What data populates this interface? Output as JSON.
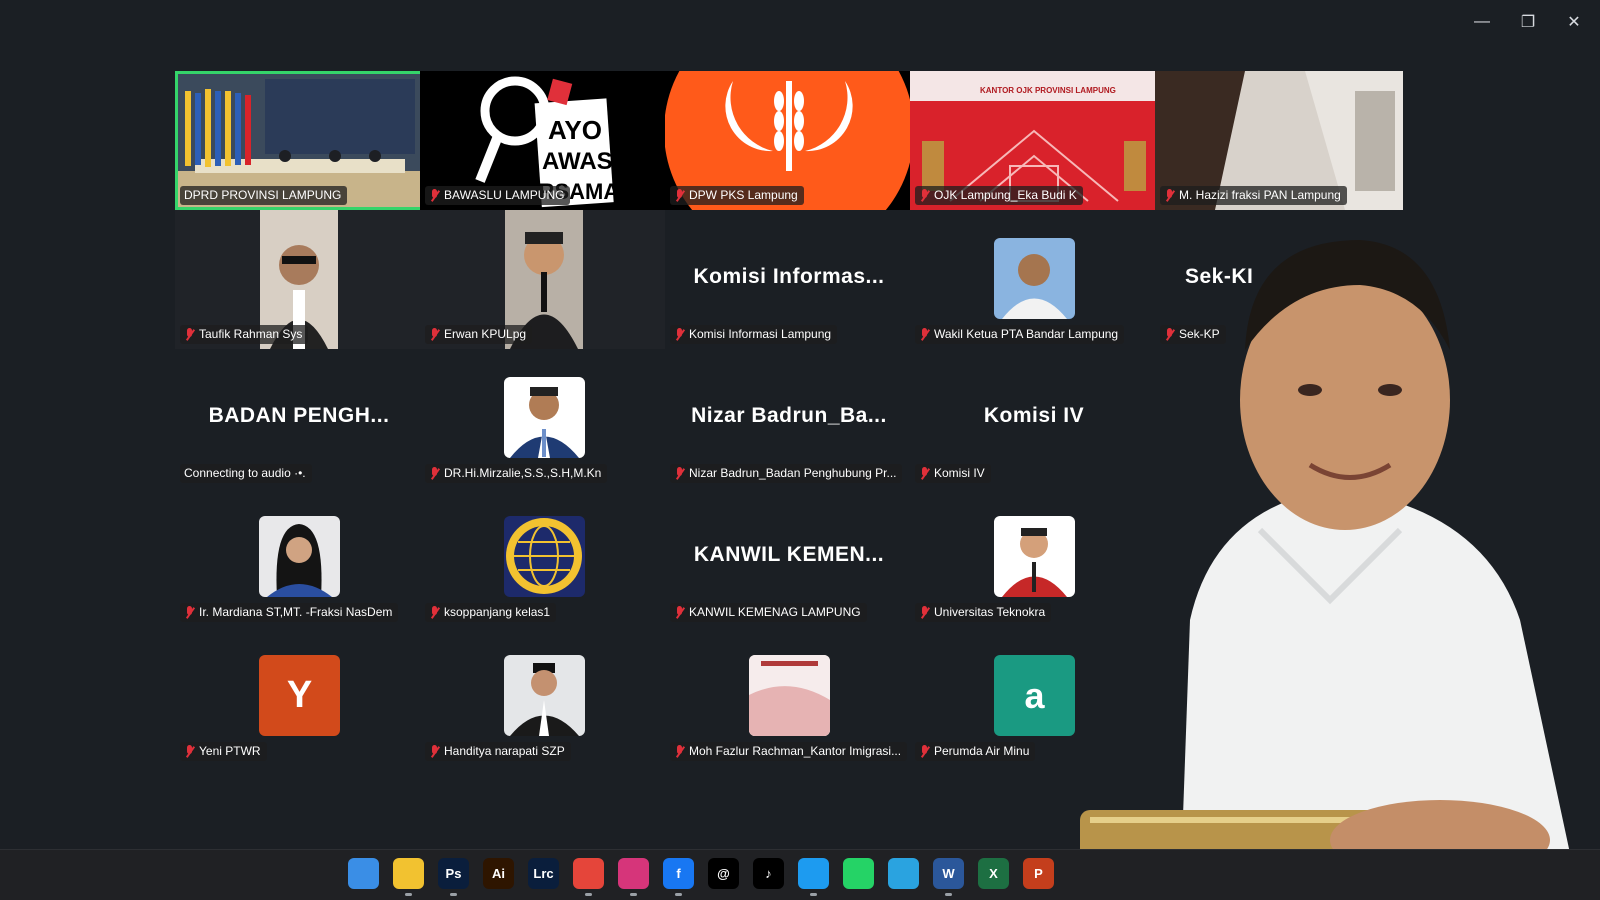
{
  "window": {
    "minimize_icon": "minimize-icon",
    "restore_icon": "restore-icon",
    "close_icon": "close-icon"
  },
  "tiles": [
    {
      "name": "DPRD PROVINSI LAMPUNG",
      "kind": "video",
      "muted": false,
      "active": true
    },
    {
      "name": "BAWASLU LAMPUNG",
      "kind": "logo",
      "logo_text": "AYO AWASI BERSAMA"
    },
    {
      "name": "DPW PKS Lampung",
      "kind": "logo"
    },
    {
      "name": "OJK Lampung_Eka Budi K",
      "kind": "banner",
      "banner_text": "KANTOR OJK PROVINSI LAMPUNG"
    },
    {
      "name": "M. Hazizi fraksi PAN Lampung",
      "kind": "video"
    },
    {
      "name": "Taufik Rahman Sys",
      "kind": "video"
    },
    {
      "name": "Erwan KPULpg",
      "kind": "video"
    },
    {
      "name": "Komisi Informasi Lampung",
      "kind": "text",
      "display": "Komisi  Informas..."
    },
    {
      "name": "Wakil Ketua  PTA Bandar Lampung",
      "kind": "avatar"
    },
    {
      "name": "Sek-KP",
      "kind": "text",
      "display": "Sek-KI"
    },
    {
      "name": "Connecting to audio ·•.",
      "kind": "text",
      "display": "BADAN  PENGH...",
      "connecting": true
    },
    {
      "name": "DR.Hi.Mirzalie,S.S.,S.H,M.Kn",
      "kind": "avatar"
    },
    {
      "name": "Nizar Badrun_Badan Penghubung Pr...",
      "kind": "text",
      "display": "Nizar  Badrun_Ba..."
    },
    {
      "name": "Komisi IV",
      "kind": "text",
      "display": "Komisi IV"
    },
    {
      "name": "Ir. Mardiana ST,MT. -Fraksi NasDem",
      "kind": "avatar"
    },
    {
      "name": "ksoppanjang kelas1",
      "kind": "avatar"
    },
    {
      "name": "KANWIL KEMENAG LAMPUNG",
      "kind": "text",
      "display": "KANWIL  KEMEN..."
    },
    {
      "name": "Universitas Teknokra",
      "kind": "avatar"
    },
    {
      "name": "Yeni PTWR",
      "kind": "letter",
      "letter": "Y"
    },
    {
      "name": "Handitya narapati SZP",
      "kind": "avatar"
    },
    {
      "name": "Moh Fazlur Rachman_Kantor Imigrasi...",
      "kind": "avatar"
    },
    {
      "name": "Perumda Air Minu",
      "kind": "letter",
      "letter": "a"
    }
  ],
  "taskbar": {
    "items": [
      {
        "icon": "windows-start-icon",
        "label": "",
        "color": "#3a8ee6"
      },
      {
        "icon": "file-explorer-icon",
        "label": "",
        "color": "#f2c230"
      },
      {
        "icon": "photoshop-icon",
        "label": "Ps",
        "color": "#0a1e3c"
      },
      {
        "icon": "illustrator-icon",
        "label": "Ai",
        "color": "#2e1500"
      },
      {
        "icon": "lightroom-classic-icon",
        "label": "Lrc",
        "color": "#0a1e3c"
      },
      {
        "icon": "chrome-icon",
        "label": "",
        "color": "#e5453a"
      },
      {
        "icon": "instagram-icon",
        "label": "",
        "color": "#d6357a"
      },
      {
        "icon": "facebook-icon",
        "label": "f",
        "color": "#1877f2"
      },
      {
        "icon": "threads-icon",
        "label": "@",
        "color": "#000000"
      },
      {
        "icon": "tiktok-icon",
        "label": "♪",
        "color": "#000000"
      },
      {
        "icon": "twitter-icon",
        "label": "",
        "color": "#1d9bf0"
      },
      {
        "icon": "whatsapp-icon",
        "label": "",
        "color": "#25d366"
      },
      {
        "icon": "telegram-icon",
        "label": "",
        "color": "#2aa3e0"
      },
      {
        "icon": "word-icon",
        "label": "W",
        "color": "#2b579a"
      },
      {
        "icon": "excel-icon",
        "label": "X",
        "color": "#1d6f42"
      },
      {
        "icon": "powerpoint-icon",
        "label": "P",
        "color": "#c43e1c"
      }
    ]
  },
  "colors": {
    "active_border": "#35d46a",
    "muted_mic": "#e0303a",
    "pks_orange": "#ff5a1a",
    "ojk_red": "#d9222b"
  }
}
